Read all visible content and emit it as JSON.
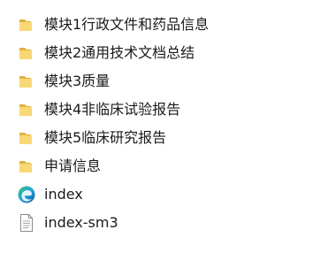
{
  "items": [
    {
      "label": "模块1行政文件和药品信息",
      "icon": "folder-icon"
    },
    {
      "label": "模块2通用技术文档总结",
      "icon": "folder-icon"
    },
    {
      "label": "模块3质量",
      "icon": "folder-icon"
    },
    {
      "label": "模块4非临床试验报告",
      "icon": "folder-icon"
    },
    {
      "label": "模块5临床研究报告",
      "icon": "folder-icon"
    },
    {
      "label": "申请信息",
      "icon": "folder-icon"
    },
    {
      "label": "index",
      "icon": "edge-html-icon"
    },
    {
      "label": "index-sm3",
      "icon": "text-file-icon"
    }
  ],
  "colors": {
    "folder_front": "#F8D775",
    "folder_back": "#E0B13F",
    "edge_blue": "#0C59A4",
    "edge_green": "#36C36B",
    "edge_cyan": "#1FA2E0",
    "file_outline": "#8A8A8A"
  }
}
